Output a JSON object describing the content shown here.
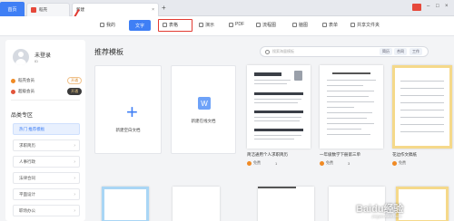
{
  "tabs": {
    "home": "首页",
    "docs": "稻壳",
    "new": "新建",
    "add": "+"
  },
  "toolbar": {
    "mine": "我的",
    "new_doc": "文字",
    "table": "表格",
    "present": "演示",
    "pdf": "PDF",
    "flow": "流程图",
    "mind": "脑图",
    "form": "表单",
    "share": "共享文件夹"
  },
  "user": {
    "name": "未登录",
    "id": "ID",
    "member1": "稻壳会员",
    "member1_btn": "开通",
    "member2": "超级会员",
    "member2_btn": "开通"
  },
  "sidebar": {
    "section_title": "品类专区",
    "items": [
      {
        "label": "热门 推荐模板"
      },
      {
        "label": "求职简历"
      },
      {
        "label": "人事行政"
      },
      {
        "label": "法律合同"
      },
      {
        "label": "平面设计"
      },
      {
        "label": "职场办公"
      }
    ]
  },
  "main": {
    "title": "推荐模板",
    "search_placeholder": "搜索海量模板",
    "chips": [
      "简历",
      "合同",
      "工作"
    ],
    "cards": {
      "blank_label": "新建空白文档",
      "wps_label": "新建在线文档",
      "wps_icon": "W"
    },
    "docs": [
      {
        "caption": "简洁通用个人求职简历",
        "tag": "免费",
        "count": "1"
      },
      {
        "caption": "一年级数学下册第三单",
        "tag": "免费",
        "count": "3"
      },
      {
        "caption": "信息考试卷"
      },
      {
        "caption": "花边作文稿纸",
        "tag": "免费"
      }
    ]
  },
  "watermark": {
    "text": "Baidu经验",
    "sub": "jingyan.baidu.com"
  },
  "colors": {
    "accent": "#3f7ff5",
    "annotation": "#e23b33"
  }
}
